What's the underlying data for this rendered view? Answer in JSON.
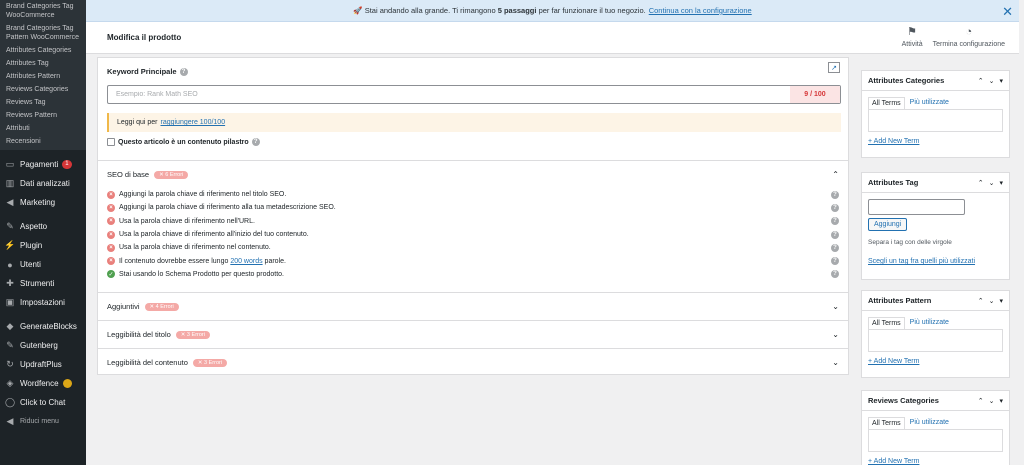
{
  "sidebar": {
    "sub_items": [
      "Brand Categories Tag WooCommerce",
      "Brand Categories Tag Pattern WooCommerce",
      "Attributes Categories",
      "Attributes Tag",
      "Attributes Pattern",
      "Reviews Categories",
      "Reviews Tag",
      "Reviews Pattern",
      "Attributi",
      "Recensioni"
    ],
    "menu_group1": [
      {
        "label": "Pagamenti",
        "icon": "card-icon",
        "badge": "1"
      },
      {
        "label": "Dati analizzati",
        "icon": "chart-icon"
      },
      {
        "label": "Marketing",
        "icon": "megaphone-icon"
      }
    ],
    "menu_group2": [
      {
        "label": "Aspetto",
        "icon": "brush-icon"
      },
      {
        "label": "Plugin",
        "icon": "plug-icon"
      },
      {
        "label": "Utenti",
        "icon": "user-icon"
      },
      {
        "label": "Strumenti",
        "icon": "wrench-icon"
      },
      {
        "label": "Impostazioni",
        "icon": "settings-icon"
      }
    ],
    "menu_group3": [
      {
        "label": "GenerateBlocks",
        "icon": "blocks-icon"
      },
      {
        "label": "Gutenberg",
        "icon": "pen-icon"
      },
      {
        "label": "UpdraftPlus",
        "icon": "backup-icon"
      },
      {
        "label": "Wordfence",
        "icon": "shield-icon"
      },
      {
        "label": "Click to Chat",
        "icon": "chat-icon"
      }
    ],
    "collapse_label": "Riduci menu"
  },
  "notice": {
    "text_before": "🚀 Stai andando alla grande. Ti rimangono ",
    "bold": "5 passaggi",
    "text_after": " per far funzionare il tuo negozio.",
    "link": "Continua con la configurazione"
  },
  "header": {
    "title": "Modifica il prodotto",
    "activity_label": "Attività",
    "finish_label": "Termina configurazione"
  },
  "seo": {
    "keyword_label": "Keyword Principale",
    "keyword_placeholder": "Esempio: Rank Math SEO",
    "score": "9 / 100",
    "warn_text": "Leggi qui per",
    "warn_link": "raggiungere 100/100",
    "pillar_label": "Questo articolo è un contenuto pilastro",
    "sections": [
      {
        "title": "SEO di base",
        "errors": "✕ 6 Errori"
      },
      {
        "title": "Aggiuntivi",
        "errors": "✕ 4 Errori"
      },
      {
        "title": "Leggibilità del titolo",
        "errors": "✕ 3 Errori"
      },
      {
        "title": "Leggibilità del contenuto",
        "errors": "✕ 3 Errori"
      }
    ],
    "checks": [
      {
        "text": "Aggiungi la parola chiave di riferimento nel titolo SEO.",
        "ok": false
      },
      {
        "text": "Aggiungi la parola chiave di riferimento alla tua metadescrizione SEO.",
        "ok": false
      },
      {
        "text": "Usa la parola chiave di riferimento nell'URL.",
        "ok": false
      },
      {
        "text": "Usa la parola chiave di riferimento all'inizio del tuo contenuto.",
        "ok": false
      },
      {
        "text": "Usa la parola chiave di riferimento nel contenuto.",
        "ok": false
      },
      {
        "text_before": "Il contenuto dovrebbe essere lungo ",
        "link": "200 words",
        "text_after": " parole.",
        "ok": false
      },
      {
        "text": "Stai usando lo Schema Prodotto per questo prodotto.",
        "ok": true
      }
    ]
  },
  "boxes": {
    "attr_categories": {
      "title": "Attributes Categories",
      "tab_all": "All Terms",
      "tab_most": "Più utilizzate",
      "add": "+ Add New Term"
    },
    "attr_tag": {
      "title": "Attributes Tag",
      "button": "Aggiungi",
      "help": "Separa i tag con delle virgole",
      "choose": "Scegli un tag fra quelli più utilizzati"
    },
    "attr_pattern": {
      "title": "Attributes Pattern",
      "tab_all": "All Terms",
      "tab_most": "Più utilizzate",
      "add": "+ Add New Term"
    },
    "rev_categories": {
      "title": "Reviews Categories",
      "tab_all": "All Terms",
      "tab_most": "Più utilizzate",
      "add": "+ Add New Term"
    }
  },
  "colors": {
    "accent": "#2271b1",
    "error": "#d63638",
    "ok": "#50a050",
    "sidebar": "#1d2327"
  }
}
